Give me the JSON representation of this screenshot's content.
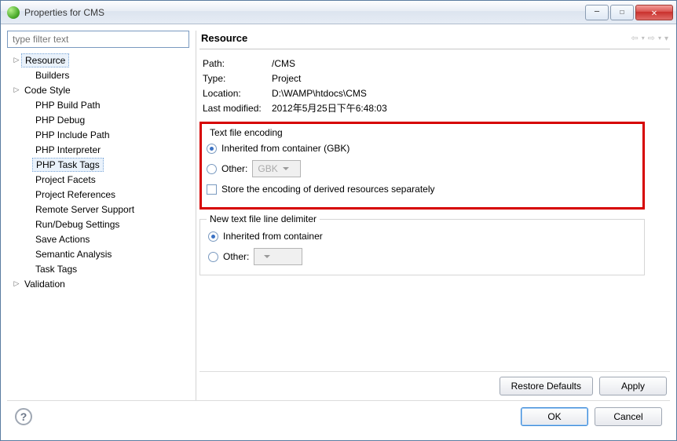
{
  "window": {
    "title": "Properties for CMS"
  },
  "sidebar": {
    "filter_placeholder": "type filter text",
    "items": [
      {
        "label": "Resource",
        "depth": 0,
        "has_children": true,
        "selected": true
      },
      {
        "label": "Builders",
        "depth": 1,
        "has_children": false,
        "selected": false
      },
      {
        "label": "Code Style",
        "depth": 0,
        "has_children": true,
        "selected": false
      },
      {
        "label": "PHP Build Path",
        "depth": 1,
        "has_children": false,
        "selected": false
      },
      {
        "label": "PHP Debug",
        "depth": 1,
        "has_children": false,
        "selected": false
      },
      {
        "label": "PHP Include Path",
        "depth": 1,
        "has_children": false,
        "selected": false
      },
      {
        "label": "PHP Interpreter",
        "depth": 1,
        "has_children": false,
        "selected": false
      },
      {
        "label": "PHP Task Tags",
        "depth": 1,
        "has_children": false,
        "selected": true
      },
      {
        "label": "Project Facets",
        "depth": 1,
        "has_children": false,
        "selected": false
      },
      {
        "label": "Project References",
        "depth": 1,
        "has_children": false,
        "selected": false
      },
      {
        "label": "Remote Server Support",
        "depth": 1,
        "has_children": false,
        "selected": false
      },
      {
        "label": "Run/Debug Settings",
        "depth": 1,
        "has_children": false,
        "selected": false
      },
      {
        "label": "Save Actions",
        "depth": 1,
        "has_children": false,
        "selected": false
      },
      {
        "label": "Semantic Analysis",
        "depth": 1,
        "has_children": false,
        "selected": false
      },
      {
        "label": "Task Tags",
        "depth": 1,
        "has_children": false,
        "selected": false
      },
      {
        "label": "Validation",
        "depth": 0,
        "has_children": true,
        "selected": false
      }
    ]
  },
  "content": {
    "title": "Resource",
    "kv": [
      {
        "key": "Path:",
        "value": "/CMS"
      },
      {
        "key": "Type:",
        "value": "Project"
      },
      {
        "key": "Location:",
        "value": "D:\\WAMP\\htdocs\\CMS"
      },
      {
        "key": "Last modified:",
        "value": "2012年5月25日下午6:48:03"
      }
    ],
    "encoding_group": {
      "legend": "Text file encoding",
      "inherited_label": "Inherited from container (GBK)",
      "inherited_checked": true,
      "other_label": "Other:",
      "other_checked": false,
      "other_value": "GBK",
      "store_derived_label": "Store the encoding of derived resources separately",
      "store_derived_checked": false
    },
    "delimiter_group": {
      "legend": "New text file line delimiter",
      "inherited_label": "Inherited from container",
      "inherited_checked": true,
      "other_label": "Other:",
      "other_checked": false,
      "other_value": ""
    },
    "buttons": {
      "restore_defaults": "Restore Defaults",
      "apply": "Apply"
    }
  },
  "footer": {
    "ok": "OK",
    "cancel": "Cancel"
  }
}
